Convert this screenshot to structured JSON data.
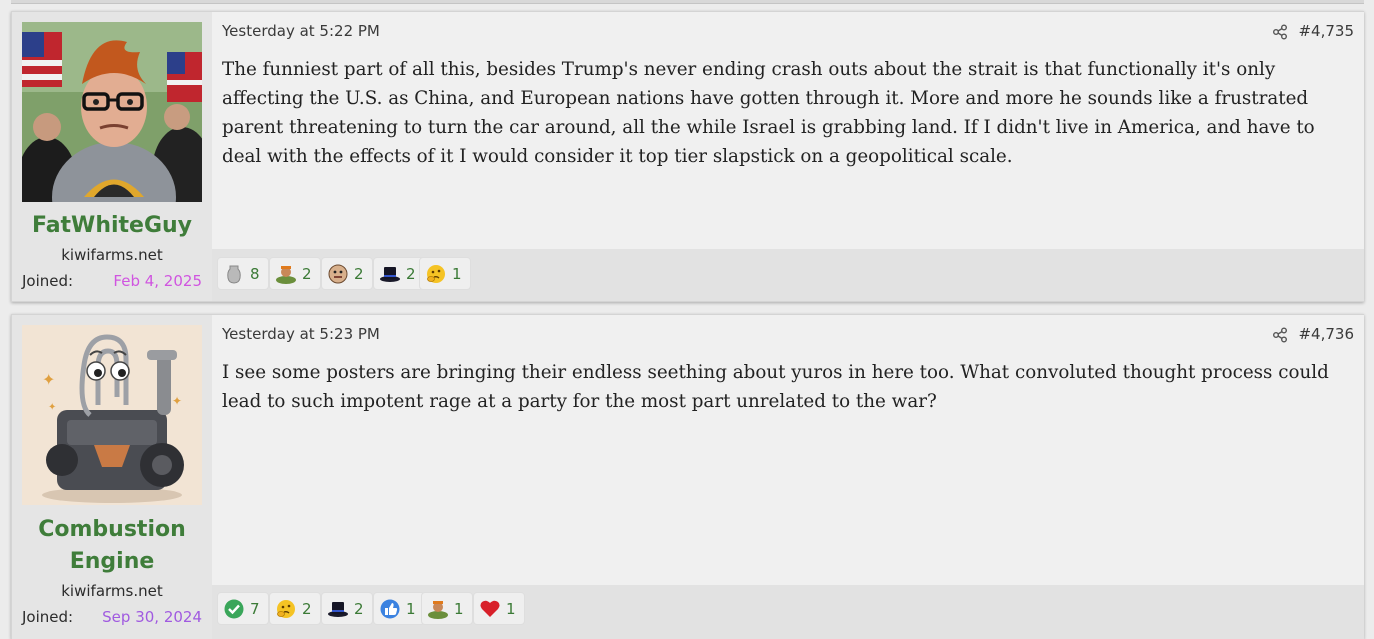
{
  "posts": [
    {
      "user": {
        "name": "FatWhiteGuy",
        "site": "kiwifarms.net",
        "joined_label": "Joined:",
        "joined_date": "Feb 4, 2025",
        "date_color": "#d055e0"
      },
      "date": "Yesterday at 5:22 PM",
      "number": "#4,735",
      "body": "The funniest part of all this, besides Trump's never ending crash outs about the strait is that functionally it's only affecting the U.S. as China, and European nations have gotten through it. More and more he sounds like a frustrated parent threatening to turn the car around, all the while Israel is grabbing land. If I didn't live in America, and have to deal with the effects of it I would consider it top tier slapstick on a geopolitical scale.",
      "reactions": [
        {
          "icon": "vase-icon",
          "count": "8"
        },
        {
          "icon": "india-icon",
          "count": "2"
        },
        {
          "icon": "face-icon",
          "count": "2"
        },
        {
          "icon": "top-hat-icon",
          "count": "2"
        },
        {
          "icon": "thinking-icon",
          "count": "1"
        }
      ]
    },
    {
      "user": {
        "name": "Combustion Engine",
        "name_line1": "Combustion",
        "name_line2": "Engine",
        "site": "kiwifarms.net",
        "joined_label": "Joined:",
        "joined_date": "Sep 30, 2024",
        "date_color": "#a05ae0"
      },
      "date": "Yesterday at 5:23 PM",
      "number": "#4,736",
      "body": "I see some posters are bringing their endless seething about yuros in here too. What convoluted thought process could lead to such impotent rage at a party for the most part unrelated to the war?",
      "reactions": [
        {
          "icon": "checkmark-icon",
          "count": "7"
        },
        {
          "icon": "thinking-icon",
          "count": "2"
        },
        {
          "icon": "top-hat-icon",
          "count": "2"
        },
        {
          "icon": "thumbs-up-icon",
          "count": "1"
        },
        {
          "icon": "india-icon",
          "count": "1"
        },
        {
          "icon": "heart-icon",
          "count": "1"
        }
      ]
    }
  ]
}
